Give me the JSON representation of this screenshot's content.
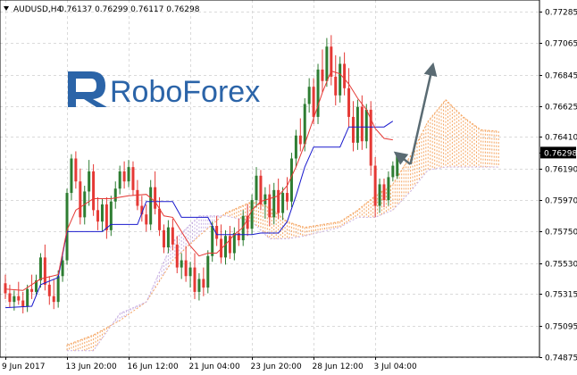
{
  "header": {
    "symbol": "AUDUSD,H4",
    "ohlc": "0.76137 0.76299 0.76117 0.76298",
    "collapse_icon": "triangle-down-icon"
  },
  "logo": {
    "text": "RoboForex",
    "icon": "roboforex-r-logo-icon",
    "color": "#2b64a8"
  },
  "colors": {
    "bull_candle": "#2e7d32",
    "bear_candle": "#e53935",
    "tenkan": "#e53935",
    "kijun": "#1a1acd",
    "kumo_bull": "#f5a561",
    "kumo_bear": "#c9b2e3",
    "arrow": "#5a6b73",
    "grid": "#dadada"
  },
  "chart_data": {
    "type": "candlestick",
    "symbol": "AUDUSD",
    "timeframe": "H4",
    "current_price": 0.76298,
    "current_price_label": "0.76298",
    "ylim": [
      0.74875,
      0.77365
    ],
    "y_ticks": [
      0.74875,
      0.75095,
      0.75315,
      0.7553,
      0.7575,
      0.7597,
      0.7619,
      0.7641,
      0.76625,
      0.76845,
      0.77065,
      0.77285
    ],
    "y_tick_labels": [
      "0.74875",
      "0.75095",
      "0.75315",
      "0.75530",
      "0.75750",
      "0.75970",
      "0.76190",
      "0.76410",
      "0.76625",
      "0.76845",
      "0.77065",
      "0.77285"
    ],
    "x_ticks": [
      {
        "label": "9 Jun 2017",
        "bar": 0
      },
      {
        "label": "13 Jun 20:00",
        "bar": 14
      },
      {
        "label": "16 Jun 12:00",
        "bar": 28
      },
      {
        "label": "21 Jun 04:00",
        "bar": 42
      },
      {
        "label": "23 Jun 20:00",
        "bar": 56
      },
      {
        "label": "28 Jun 12:00",
        "bar": 70
      },
      {
        "label": "3 Jul 04:00",
        "bar": 84
      }
    ],
    "candles": [
      [
        0.7539,
        0.7545,
        0.7528,
        0.7532
      ],
      [
        0.7532,
        0.7538,
        0.7522,
        0.7526
      ],
      [
        0.7526,
        0.7534,
        0.752,
        0.753
      ],
      [
        0.753,
        0.754,
        0.7524,
        0.7527
      ],
      [
        0.7527,
        0.7533,
        0.7518,
        0.7523
      ],
      [
        0.7523,
        0.7538,
        0.7519,
        0.7535
      ],
      [
        0.7535,
        0.7545,
        0.7528,
        0.7533
      ],
      [
        0.7533,
        0.7545,
        0.753,
        0.7541
      ],
      [
        0.7541,
        0.756,
        0.7536,
        0.7557
      ],
      [
        0.7557,
        0.7566,
        0.7534,
        0.7538
      ],
      [
        0.7538,
        0.7544,
        0.7524,
        0.753
      ],
      [
        0.753,
        0.7542,
        0.7521,
        0.7526
      ],
      [
        0.7526,
        0.7548,
        0.7522,
        0.7544
      ],
      [
        0.7544,
        0.7558,
        0.754,
        0.7555
      ],
      [
        0.7555,
        0.7605,
        0.7552,
        0.7602
      ],
      [
        0.7602,
        0.7629,
        0.7597,
        0.7626
      ],
      [
        0.7626,
        0.7631,
        0.7605,
        0.761
      ],
      [
        0.761,
        0.7619,
        0.758,
        0.7585
      ],
      [
        0.7585,
        0.7607,
        0.758,
        0.7603
      ],
      [
        0.7603,
        0.7625,
        0.7593,
        0.7617
      ],
      [
        0.7617,
        0.7622,
        0.7586,
        0.759
      ],
      [
        0.759,
        0.7599,
        0.7576,
        0.7582
      ],
      [
        0.7582,
        0.7598,
        0.7575,
        0.7594
      ],
      [
        0.7594,
        0.7599,
        0.757,
        0.7576
      ],
      [
        0.7576,
        0.76,
        0.7572,
        0.7596
      ],
      [
        0.7596,
        0.761,
        0.7591,
        0.7605
      ],
      [
        0.7605,
        0.7621,
        0.7601,
        0.7617
      ],
      [
        0.7617,
        0.7624,
        0.7605,
        0.761
      ],
      [
        0.761,
        0.7625,
        0.7606,
        0.762
      ],
      [
        0.762,
        0.7624,
        0.76,
        0.7604
      ],
      [
        0.7604,
        0.7611,
        0.759,
        0.7593
      ],
      [
        0.7593,
        0.76,
        0.7582,
        0.7587
      ],
      [
        0.7587,
        0.7594,
        0.7575,
        0.758
      ],
      [
        0.758,
        0.7611,
        0.7576,
        0.7606
      ],
      [
        0.7606,
        0.7617,
        0.7587,
        0.7591
      ],
      [
        0.7591,
        0.7599,
        0.7572,
        0.7576
      ],
      [
        0.7576,
        0.758,
        0.756,
        0.7564
      ],
      [
        0.7564,
        0.7583,
        0.756,
        0.7578
      ],
      [
        0.7578,
        0.7584,
        0.7562,
        0.7566
      ],
      [
        0.7566,
        0.7572,
        0.7546,
        0.755
      ],
      [
        0.755,
        0.756,
        0.7542,
        0.7555
      ],
      [
        0.7555,
        0.7565,
        0.754,
        0.7544
      ],
      [
        0.7544,
        0.7554,
        0.7536,
        0.755
      ],
      [
        0.755,
        0.756,
        0.7528,
        0.7533
      ],
      [
        0.7533,
        0.7546,
        0.7527,
        0.7542
      ],
      [
        0.7542,
        0.755,
        0.753,
        0.7536
      ],
      [
        0.7536,
        0.7562,
        0.7532,
        0.7558
      ],
      [
        0.7558,
        0.7582,
        0.7554,
        0.7579
      ],
      [
        0.7579,
        0.7586,
        0.7565,
        0.757
      ],
      [
        0.757,
        0.758,
        0.7553,
        0.7557
      ],
      [
        0.7557,
        0.7576,
        0.7552,
        0.7572
      ],
      [
        0.7572,
        0.7579,
        0.7556,
        0.756
      ],
      [
        0.756,
        0.7578,
        0.7555,
        0.7574
      ],
      [
        0.7574,
        0.7584,
        0.7565,
        0.7569
      ],
      [
        0.7569,
        0.759,
        0.7565,
        0.7586
      ],
      [
        0.7586,
        0.7594,
        0.7572,
        0.7577
      ],
      [
        0.7577,
        0.7601,
        0.7573,
        0.7597
      ],
      [
        0.7597,
        0.762,
        0.7592,
        0.7614
      ],
      [
        0.7614,
        0.7618,
        0.759,
        0.7594
      ],
      [
        0.7594,
        0.7606,
        0.7584,
        0.7601
      ],
      [
        0.7601,
        0.7608,
        0.7579,
        0.7585
      ],
      [
        0.7585,
        0.7609,
        0.758,
        0.7604
      ],
      [
        0.7604,
        0.7612,
        0.7584,
        0.7588
      ],
      [
        0.7588,
        0.7606,
        0.7583,
        0.7602
      ],
      [
        0.7602,
        0.7613,
        0.759,
        0.7596
      ],
      [
        0.7596,
        0.763,
        0.7592,
        0.7626
      ],
      [
        0.7626,
        0.7646,
        0.762,
        0.7642
      ],
      [
        0.7642,
        0.7654,
        0.7631,
        0.7636
      ],
      [
        0.7636,
        0.7668,
        0.7631,
        0.7664
      ],
      [
        0.7664,
        0.7682,
        0.7658,
        0.7676
      ],
      [
        0.7676,
        0.7682,
        0.765,
        0.7655
      ],
      [
        0.7655,
        0.7692,
        0.765,
        0.7688
      ],
      [
        0.7688,
        0.7702,
        0.7672,
        0.768
      ],
      [
        0.768,
        0.771,
        0.7676,
        0.7704
      ],
      [
        0.7704,
        0.7712,
        0.7677,
        0.7683
      ],
      [
        0.7683,
        0.7698,
        0.7663,
        0.767
      ],
      [
        0.767,
        0.7697,
        0.7665,
        0.7692
      ],
      [
        0.7692,
        0.77,
        0.767,
        0.7675
      ],
      [
        0.7675,
        0.7689,
        0.7648,
        0.7655
      ],
      [
        0.7655,
        0.7666,
        0.7631,
        0.7637
      ],
      [
        0.7637,
        0.7667,
        0.7632,
        0.7662
      ],
      [
        0.7662,
        0.767,
        0.7632,
        0.7638
      ],
      [
        0.7638,
        0.7664,
        0.7633,
        0.766
      ],
      [
        0.766,
        0.7666,
        0.7614,
        0.7621
      ],
      [
        0.7621,
        0.7627,
        0.7585,
        0.7593
      ],
      [
        0.7593,
        0.7612,
        0.7588,
        0.7608
      ],
      [
        0.7608,
        0.7612,
        0.7592,
        0.7597
      ],
      [
        0.7597,
        0.7617,
        0.7593,
        0.7613
      ],
      [
        0.7613,
        0.7624,
        0.761,
        0.7621
      ],
      [
        0.76137,
        0.76299,
        0.76117,
        0.76298
      ]
    ],
    "tenkan": [
      [
        0,
        0.7535
      ],
      [
        4,
        0.7534
      ],
      [
        8,
        0.7542
      ],
      [
        12,
        0.7545
      ],
      [
        14,
        0.7576
      ],
      [
        16,
        0.759
      ],
      [
        20,
        0.7598
      ],
      [
        24,
        0.7598
      ],
      [
        28,
        0.76
      ],
      [
        32,
        0.7601
      ],
      [
        34,
        0.7596
      ],
      [
        36,
        0.7586
      ],
      [
        38,
        0.7585
      ],
      [
        40,
        0.7575
      ],
      [
        42,
        0.7565
      ],
      [
        44,
        0.7558
      ],
      [
        46,
        0.756
      ],
      [
        48,
        0.756
      ],
      [
        50,
        0.7566
      ],
      [
        52,
        0.7573
      ],
      [
        54,
        0.7578
      ],
      [
        56,
        0.759
      ],
      [
        58,
        0.7596
      ],
      [
        60,
        0.7598
      ],
      [
        62,
        0.76
      ],
      [
        64,
        0.7607
      ],
      [
        66,
        0.762
      ],
      [
        68,
        0.7636
      ],
      [
        70,
        0.7654
      ],
      [
        72,
        0.7672
      ],
      [
        74,
        0.7687
      ],
      [
        76,
        0.7685
      ],
      [
        78,
        0.7678
      ],
      [
        80,
        0.7668
      ],
      [
        82,
        0.766
      ],
      [
        84,
        0.7647
      ],
      [
        86,
        0.764
      ],
      [
        88,
        0.7639
      ]
    ],
    "kijun": [
      [
        0,
        0.7522
      ],
      [
        6,
        0.7523
      ],
      [
        8,
        0.7538
      ],
      [
        12,
        0.7543
      ],
      [
        14,
        0.7575
      ],
      [
        22,
        0.7575
      ],
      [
        24,
        0.758
      ],
      [
        30,
        0.758
      ],
      [
        32,
        0.7596
      ],
      [
        38,
        0.7596
      ],
      [
        40,
        0.7585
      ],
      [
        46,
        0.7585
      ],
      [
        48,
        0.7573
      ],
      [
        56,
        0.7573
      ],
      [
        58,
        0.7574
      ],
      [
        62,
        0.7574
      ],
      [
        64,
        0.7582
      ],
      [
        66,
        0.76
      ],
      [
        68,
        0.762
      ],
      [
        70,
        0.7634
      ],
      [
        76,
        0.7634
      ],
      [
        78,
        0.7648
      ],
      [
        86,
        0.7648
      ],
      [
        88,
        0.7652
      ]
    ],
    "span_a": [
      [
        14,
        0.7496
      ],
      [
        20,
        0.7503
      ],
      [
        26,
        0.7513
      ],
      [
        32,
        0.7526
      ],
      [
        38,
        0.7555
      ],
      [
        44,
        0.7572
      ],
      [
        50,
        0.7588
      ],
      [
        56,
        0.7596
      ],
      [
        60,
        0.7592
      ],
      [
        64,
        0.7582
      ],
      [
        68,
        0.7578
      ],
      [
        72,
        0.758
      ],
      [
        76,
        0.7582
      ],
      [
        80,
        0.759
      ],
      [
        84,
        0.76
      ],
      [
        88,
        0.7608
      ],
      [
        92,
        0.7628
      ],
      [
        96,
        0.7652
      ],
      [
        100,
        0.7667
      ],
      [
        104,
        0.7655
      ],
      [
        108,
        0.7646
      ],
      [
        112,
        0.7645
      ]
    ],
    "span_b": [
      [
        14,
        0.7492
      ],
      [
        20,
        0.7492
      ],
      [
        26,
        0.7518
      ],
      [
        32,
        0.7526
      ],
      [
        38,
        0.7568
      ],
      [
        44,
        0.7586
      ],
      [
        50,
        0.7586
      ],
      [
        56,
        0.7582
      ],
      [
        60,
        0.757
      ],
      [
        64,
        0.757
      ],
      [
        68,
        0.7572
      ],
      [
        72,
        0.7575
      ],
      [
        76,
        0.7578
      ],
      [
        80,
        0.7585
      ],
      [
        84,
        0.7585
      ],
      [
        88,
        0.759
      ],
      [
        92,
        0.7603
      ],
      [
        96,
        0.7618
      ],
      [
        100,
        0.762
      ],
      [
        104,
        0.762
      ],
      [
        108,
        0.762
      ],
      [
        112,
        0.762
      ]
    ],
    "forecast_arrows": [
      {
        "from": [
          92,
          0.7622
        ],
        "to": [
          89,
          0.7629
        ]
      },
      {
        "from": [
          92,
          0.7622
        ],
        "to": [
          97,
          0.769
        ]
      }
    ]
  }
}
